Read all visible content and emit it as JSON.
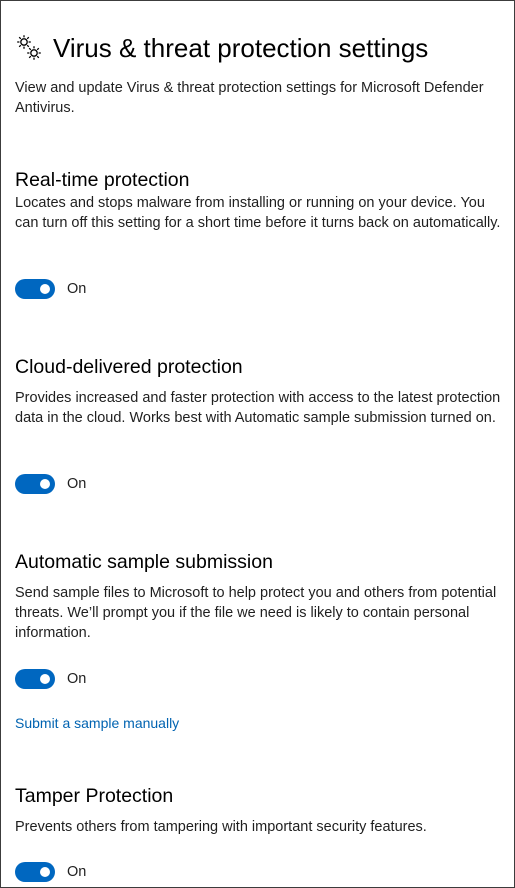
{
  "header": {
    "icon": "gear-icon",
    "title": "Virus & threat protection settings"
  },
  "intro": "View and update Virus & threat protection settings for Microsoft Defender Antivirus.",
  "accent_color": "#0067c0",
  "link_color": "#0063b1",
  "sections": [
    {
      "title": "Real-time protection",
      "description": "Locates and stops malware from installing or running on your device. You can turn off this setting for a short time before it turns back on automatically.",
      "toggle_state": true,
      "toggle_label": "On"
    },
    {
      "title": "Cloud-delivered protection",
      "description": "Provides increased and faster protection with access to the latest protection data in the cloud. Works best with Automatic sample submission turned on.",
      "toggle_state": true,
      "toggle_label": "On"
    },
    {
      "title": "Automatic sample submission",
      "description": "Send sample files to Microsoft to help protect you and others from potential threats. We’ll prompt you if the file we need is likely to contain personal information.",
      "toggle_state": true,
      "toggle_label": "On",
      "link": "Submit a sample manually"
    },
    {
      "title": "Tamper Protection",
      "description": "Prevents others from tampering with important security features.",
      "toggle_state": true,
      "toggle_label": "On"
    }
  ]
}
